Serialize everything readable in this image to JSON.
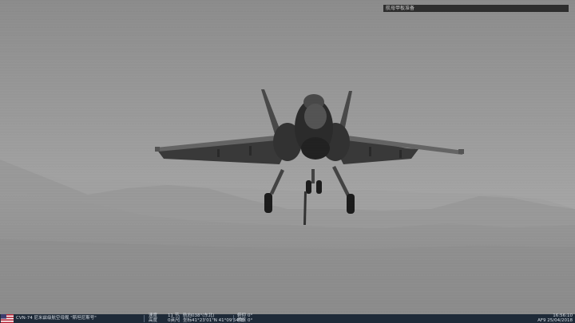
{
  "hud": {
    "top_message": "航母甲板准备"
  },
  "status_bar": {
    "unit": "CVN-74 尼米兹级航空母舰 \"斯坦尼斯号\"",
    "speed_label": "速度",
    "speed_value": "11 节",
    "altitude_label": "高度",
    "altitude_value": "0英尺",
    "heading_label": "航向",
    "heading_value": "038°(东北)",
    "position_label": "坐标",
    "position_value": "41°23'01\"N 41°09'54\"E",
    "pitch_label": "俯仰",
    "pitch_value": "0°",
    "roll_label": "横滚",
    "roll_value": "0°",
    "clock_time": "16:56:10",
    "clock_date": "AF9 25/04/2018"
  }
}
